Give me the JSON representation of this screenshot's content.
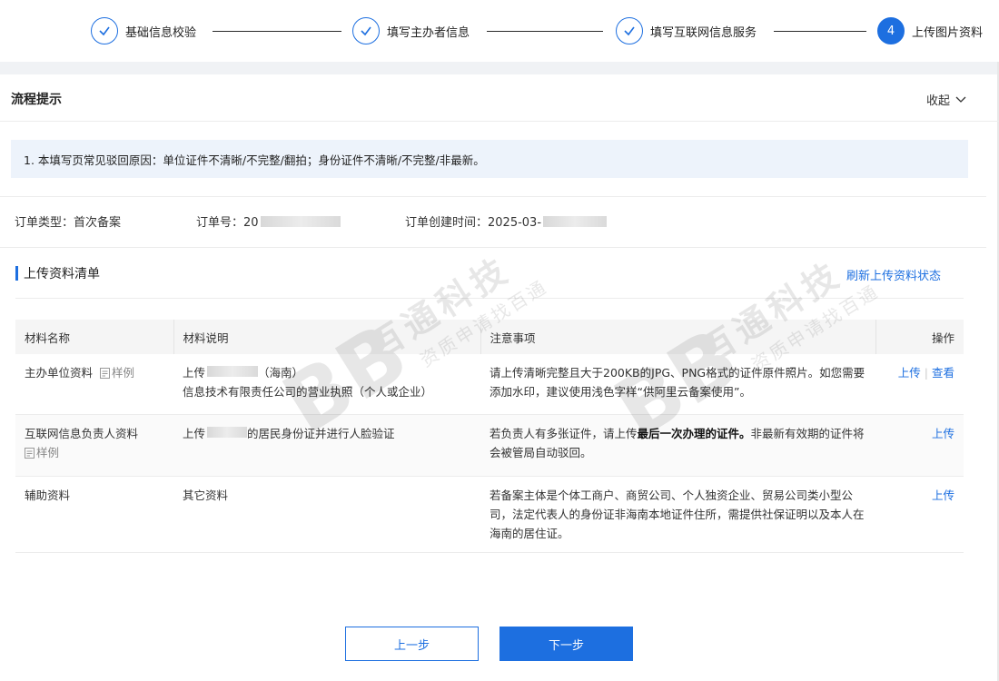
{
  "steps": [
    {
      "label": "基础信息校验",
      "status": "done"
    },
    {
      "label": "填写主办者信息",
      "status": "done"
    },
    {
      "label": "填写互联网信息服务",
      "status": "done"
    },
    {
      "label": "上传图片资料",
      "status": "active",
      "number": "4"
    }
  ],
  "process": {
    "title": "流程提示",
    "collapse_label": "收起",
    "tip": "1. 本填写页常见驳回原因：单位证件不清晰/不完整/翻拍；身份证件不清晰/不完整/非最新。"
  },
  "order": {
    "type_label": "订单类型：首次备案",
    "no_label": "订单号：20",
    "time_label": "订单创建时间：2025-03-"
  },
  "upload_list": {
    "title": "上传资料清单",
    "refresh_label": "刷新上传资料状态",
    "headers": [
      "材料名称",
      "材料说明",
      "注意事项",
      "操作"
    ],
    "sample_label": "样例",
    "rows": [
      {
        "name": "主办单位资料",
        "desc_prefix": "上传",
        "desc_suffix": "（海南）",
        "desc_line2": "信息技术有限责任公司的营业执照（个人或企业）",
        "note": "请上传清晰完整且大于200KB的JPG、PNG格式的证件原件照片。如您需要添加水印，建议使用浅色字样“供阿里云备案使用”。",
        "upload": "上传",
        "view": "查看"
      },
      {
        "name": "互联网信息负责人资料",
        "desc_prefix": "上传",
        "desc_suffix": "的居民身份证并进行人脸验证",
        "note_before": "若负责人有多张证件，请上传",
        "note_bold": "最后一次办理的证件。",
        "note_after": "非最新有效期的证件将会被管局自动驳回。",
        "upload": "上传"
      },
      {
        "name": "辅助资料",
        "desc": "其它资料",
        "note": "若备案主体是个体工商户、商贸公司、个人独资企业、贸易公司类小型公司，法定代表人的身份证非海南本地证件住所，需提供社保证明以及本人在海南的居住证。",
        "upload": "上传"
      }
    ]
  },
  "buttons": {
    "prev": "上一步",
    "next": "下一步"
  },
  "watermark": {
    "brand": "百通科技",
    "slogan": "资质申请找百通",
    "logo": "BB"
  },
  "colors": {
    "accent": "#1d6fe0",
    "tip_bg": "#edf3fb"
  }
}
